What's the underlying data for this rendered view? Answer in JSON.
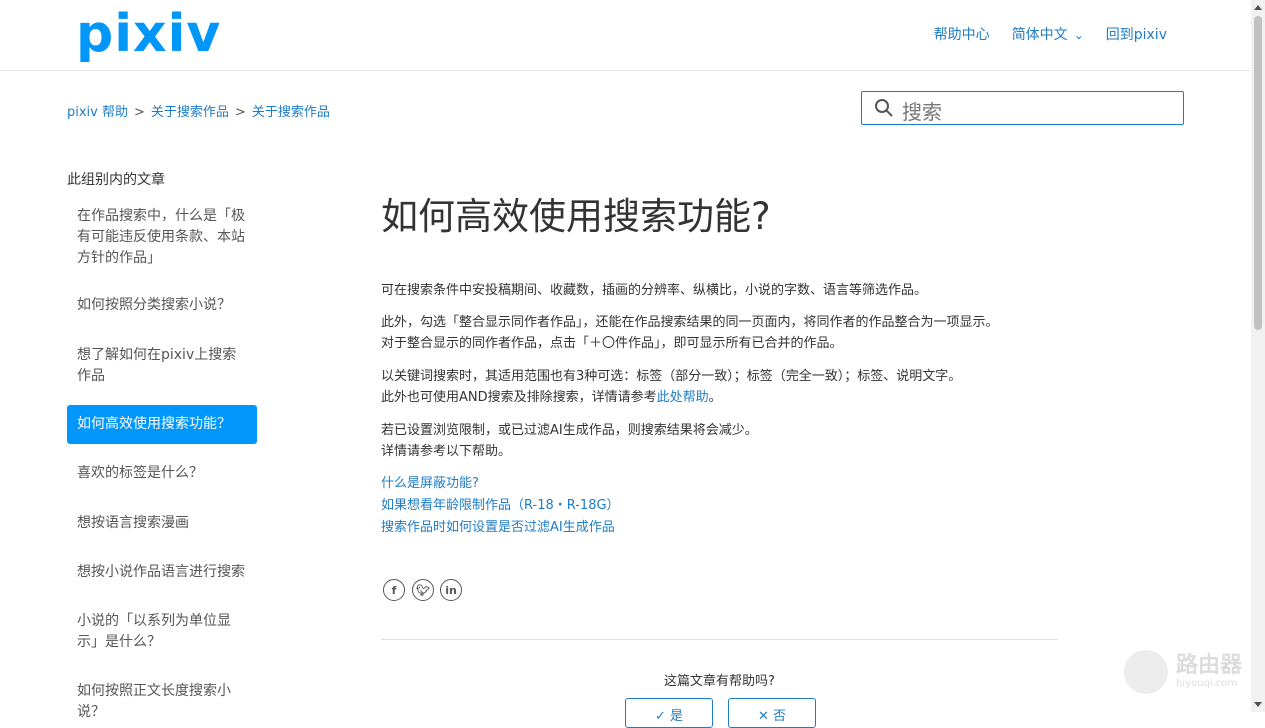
{
  "header": {
    "logo": "pixiv",
    "nav": {
      "help_center": "帮助中心",
      "language": "简体中文",
      "back": "回到pixiv"
    }
  },
  "breadcrumb": {
    "items": [
      "pixiv 帮助",
      "关于搜索作品",
      "关于搜索作品"
    ],
    "sep": ">"
  },
  "search": {
    "placeholder": "搜索",
    "icon": "search-icon"
  },
  "sidebar": {
    "title": "此组别内的文章",
    "items": [
      {
        "label": "在作品搜索中，什么是「极有可能违反使用条款、本站方针的作品」"
      },
      {
        "label": "如何按照分类搜索小说？"
      },
      {
        "label": "想了解如何在pixiv上搜索作品"
      },
      {
        "label": "如何高效使用搜索功能？",
        "active": true
      },
      {
        "label": "喜欢的标签是什么？"
      },
      {
        "label": "想按语言搜索漫画"
      },
      {
        "label": "想按小说作品语言进行搜索"
      },
      {
        "label": "小说的「以系列为单位显示」是什么？"
      },
      {
        "label": "如何按照正文长度搜索小说？"
      }
    ]
  },
  "article": {
    "title": "如何高效使用搜索功能?",
    "p1": "可在搜索条件中安投稿期间、收藏数，插画的分辨率、纵横比，小说的字数、语言等筛选作品。",
    "p2a": "此外，勾选「整合显示同作者作品」，还能在作品搜索结果的同一页面内，将同作者的作品整合为一项显示。",
    "p2b": "对于整合显示的同作者作品，点击「＋〇件作品」，即可显示所有已合并的作品。",
    "p3a": "以关键词搜索时，其适用范围也有3种可选：标签（部分一致）；标签（完全一致）；标签、说明文字。",
    "p3b_prefix": "此外也可使用AND搜索及排除搜索，详情请参考",
    "p3b_link": "此处帮助",
    "p3b_suffix": "。",
    "p4a": "若已设置浏览限制，或已过滤AI生成作品，则搜索结果将会减少。",
    "p4b": "详情请参考以下帮助。",
    "links": [
      "什么是屏蔽功能?",
      "如果想看年龄限制作品（R-18・R-18G）",
      "搜索作品时如何设置是否过滤AI生成作品"
    ],
    "social": [
      "facebook-icon",
      "twitter-icon",
      "linkedin-icon"
    ],
    "helpful_q": "这篇文章有帮助吗?",
    "vote_yes": "✓ 是",
    "vote_no": "✕ 否"
  },
  "watermark": {
    "cn": "路由器",
    "en": "luyouqi.com"
  },
  "colors": {
    "accent": "#0096fa",
    "link": "#1f7cc7"
  }
}
